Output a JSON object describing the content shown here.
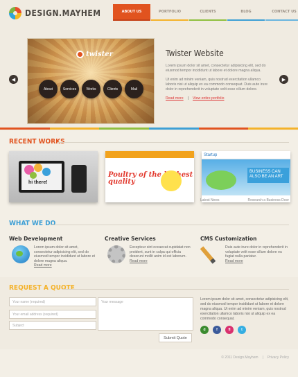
{
  "logo": {
    "text": "DESIGN.MAYHEM"
  },
  "nav": [
    {
      "label": "About us"
    },
    {
      "label": "Portfolio"
    },
    {
      "label": "Clients"
    },
    {
      "label": "Blog"
    },
    {
      "label": "Contact us"
    }
  ],
  "slider": {
    "logo_text": "twister",
    "circles": [
      "About",
      "Services",
      "Works",
      "Clients",
      "Mail"
    ],
    "title": "Twister Website",
    "p1": "Lorem ipsum dolor sit amet, consectetur adipisicing elit, sed do eiusmod tempor incididunt ut labore et dolore magna aliqua.",
    "p2": "Ut enim ad minim veniam, quis nostrud exercitation ullamco laboris nisi ut aliquip ex ea commodo consequat. Duis aute irure dolor in reprehenderit in voluptate velit esse cillum dolore.",
    "read_more": "Read more",
    "separator": "|",
    "view_portfolio": "View entire portfolio",
    "prev_icon": "chevron-left-icon",
    "next_icon": "chevron-right-icon"
  },
  "stripe_colors": [
    "#e1531f",
    "#f4b22a",
    "#8fbf3f",
    "#3d9fd5",
    "#e1531f",
    "#f4b22a"
  ],
  "recent_works": {
    "title": "Recent Works",
    "title_color": "#e1531f",
    "items": [
      {
        "alt": "hi there!"
      },
      {
        "alt": "Poultry of the highest quality",
        "text": "Poultry of the highest quality"
      },
      {
        "alt": "Business can also be an art",
        "brand": "Startup",
        "text": "BUSINESS CAN ALSO BE AN ART"
      }
    ],
    "news_label": "Latest News",
    "research_label": "Research a Business Door"
  },
  "what_we_do": {
    "title": "What we do",
    "title_color": "#3d9fd5",
    "columns": [
      {
        "title": "Web Development",
        "text": "Lorem ipsum dolor sit amet, consectetur adipisicing elit, sed do eiusmod tempor incididunt ut labore et dolore magna aliqua.",
        "read_more": "Read more",
        "icon": "globe-icon"
      },
      {
        "title": "Creative Services",
        "text": "Excepteur sint occaecat cupidatat non proident, sunt in culpa qui officia deserunt mollit anim id est laborum.",
        "read_more": "Read more",
        "icon": "gear-icon"
      },
      {
        "title": "CMS Customization",
        "text": "Duis aute irure dolor in reprehenderit in voluptate velit esse cillum dolore eu fugiat nulla pariatur.",
        "read_more": "Read more",
        "icon": "pencil-icon"
      }
    ]
  },
  "quote": {
    "title": "Request a quote",
    "title_color": "#f4b22a",
    "name_placeholder": "Your name (required)",
    "email_placeholder": "Your email address (required)",
    "subject_placeholder": "Subject",
    "message_placeholder": "Your message",
    "submit_label": "Submit Quote",
    "text": "Lorem ipsum dolor sit amet, consectetur adipisicing elit, sed do eiusmod tempor incididunt ut labore et dolore magna aliqua. Ut enim ad minim veniam, quis nostrud exercitation ullamco laboris nisi ut aliquip ex ea commodo consequat.",
    "socials": [
      {
        "label": "d",
        "icon": "delicious-icon",
        "color": "#3b8b2e"
      },
      {
        "label": "f",
        "icon": "facebook-icon",
        "color": "#3b5a9a"
      },
      {
        "label": "fl",
        "icon": "flickr-icon",
        "color": "#d9306e"
      },
      {
        "label": "t",
        "icon": "twitter-icon",
        "color": "#35aee2"
      }
    ]
  },
  "footer": {
    "copyright": "© 2011 Design.Mayhem",
    "separator": "|",
    "privacy": "Privacy Policy"
  }
}
